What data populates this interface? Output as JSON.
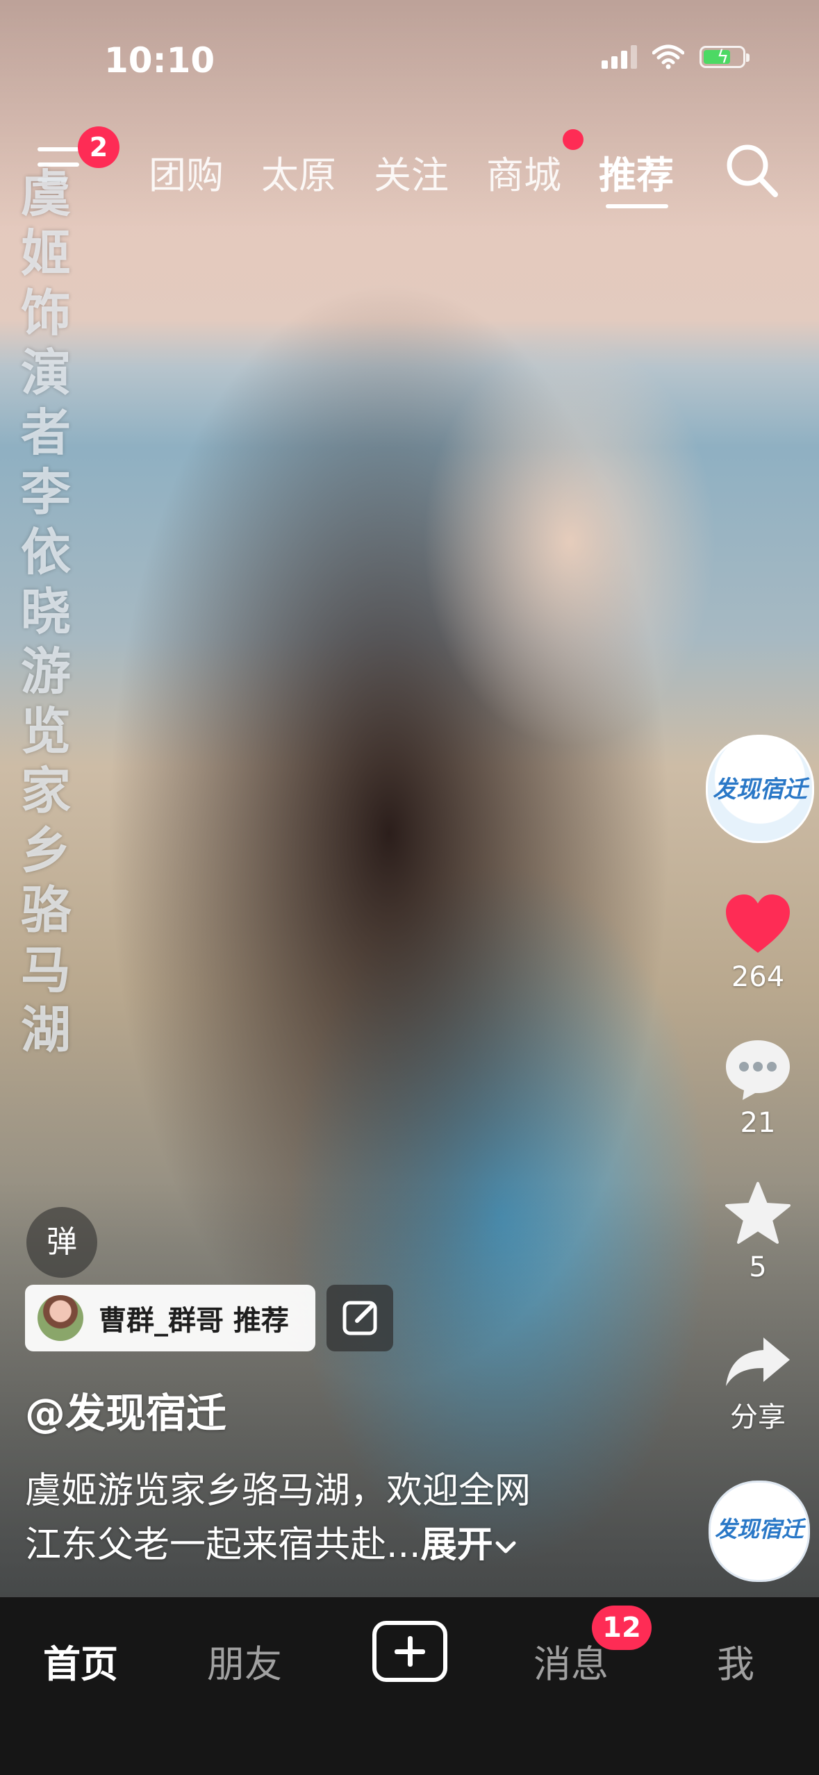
{
  "status_bar": {
    "time": "10:10"
  },
  "top_nav": {
    "menu_badge": "2",
    "tabs": [
      "团购",
      "太原",
      "关注",
      "商城",
      "推荐"
    ]
  },
  "video": {
    "vertical_caption": "虞姬饰演者李依晓游览家乡骆马湖"
  },
  "side_actions": {
    "avatar_text": "发现宿迁",
    "likes": "264",
    "comments": "21",
    "favorites": "5",
    "share_label": "分享"
  },
  "overlay": {
    "danmu_label": "弹",
    "recommend_chip": "曹群_群哥 推荐",
    "account": "@发现宿迁",
    "description_line1": "虞姬游览家乡骆马湖，欢迎全网",
    "description_line2": "江东父老一起来宿共赴...",
    "expand_label": "展开"
  },
  "bottom_nav": {
    "tabs": [
      "首页",
      "朋友",
      "消息",
      "我"
    ],
    "messages_badge": "12"
  },
  "colors": {
    "accent": "#fe2c55",
    "nav_bg": "#161616"
  }
}
